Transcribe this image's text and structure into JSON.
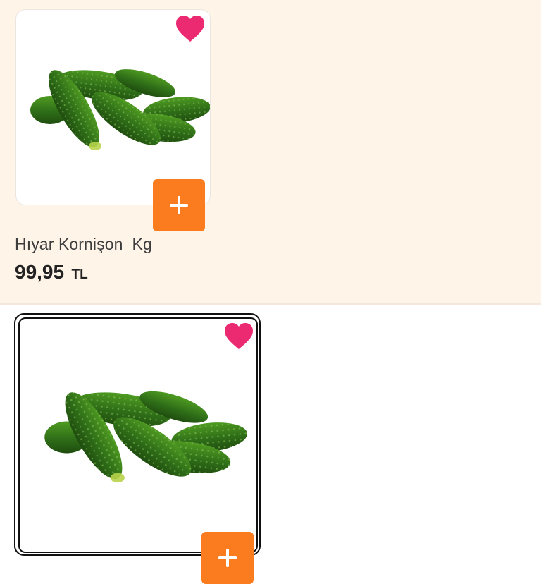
{
  "colors": {
    "background_top": "#fff4e8",
    "accent_orange": "#fb7b1f",
    "heart_pink": "#ec2a72",
    "cucumber_dark": "#2d6a17",
    "cucumber_light": "#4f9b22"
  },
  "products": [
    {
      "name": "Hıyar Kornişon  Kg",
      "price": "99,95",
      "currency": "TL",
      "image_icon": "cucumber-image",
      "favorite_icon": "heart-icon",
      "add_icon": "plus-icon"
    },
    {
      "image_icon": "cucumber-image",
      "favorite_icon": "heart-icon",
      "add_icon": "plus-icon"
    }
  ]
}
